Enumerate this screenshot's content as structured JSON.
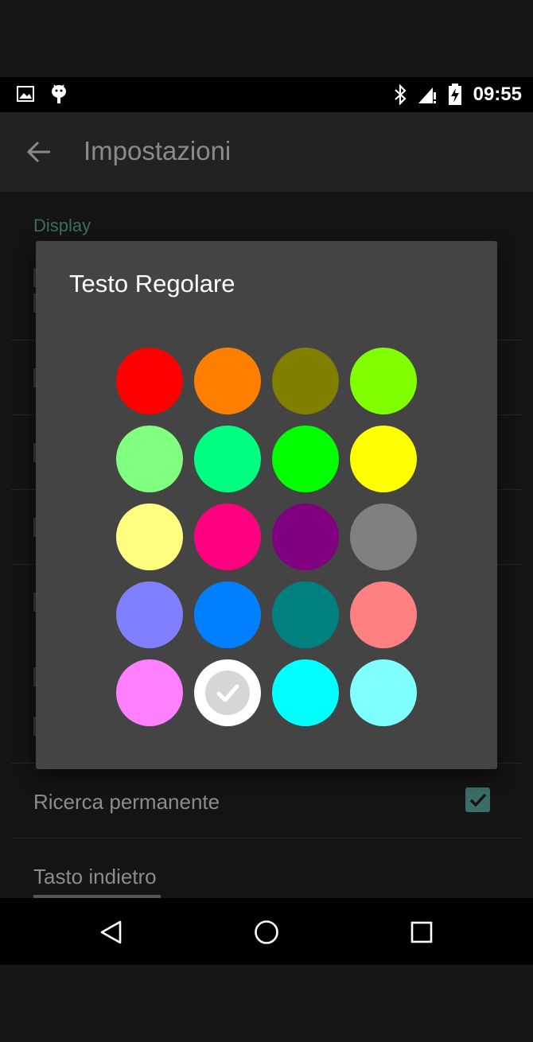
{
  "status_bar": {
    "time": "09:55"
  },
  "app_bar": {
    "title": "Impostazioni"
  },
  "settings": {
    "section_label": "Display",
    "permanent_search_label": "Ricerca permanente",
    "permanent_search_checked": true,
    "back_key_label": "Tasto indietro"
  },
  "dialog": {
    "title": "Testo Regolare",
    "selected_index": 17,
    "colors": [
      "#ff0000",
      "#ff8000",
      "#808000",
      "#80ff00",
      "#80ff80",
      "#00ff80",
      "#00ff00",
      "#ffff00",
      "#ffff80",
      "#ff0080",
      "#800080",
      "#808080",
      "#8080ff",
      "#0080ff",
      "#008080",
      "#ff8080",
      "#ff80ff",
      "#ffffff",
      "#00ffff",
      "#80ffff"
    ]
  },
  "colors": {
    "accent": "#3a6d68",
    "dialog_background": "#444444"
  }
}
